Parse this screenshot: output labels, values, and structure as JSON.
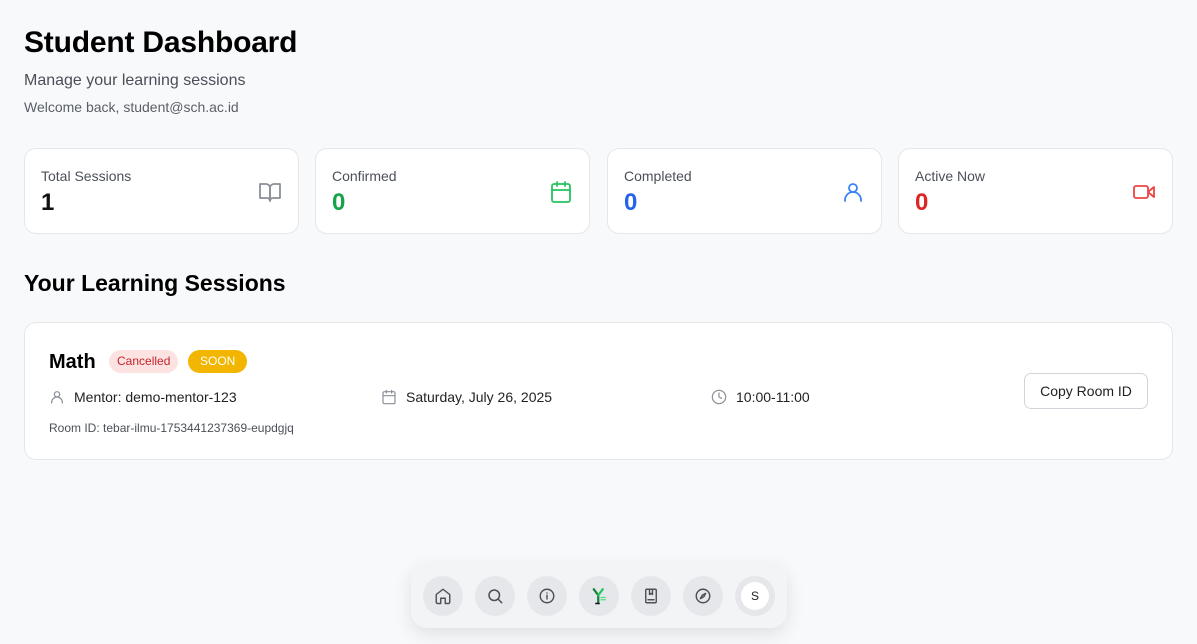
{
  "header": {
    "title": "Student Dashboard",
    "subtitle": "Manage your learning sessions",
    "welcome": "Welcome back, student@sch.ac.id"
  },
  "stats": [
    {
      "label": "Total Sessions",
      "value": "1",
      "icon": "book-open-icon",
      "color": "#111111"
    },
    {
      "label": "Confirmed",
      "value": "0",
      "icon": "calendar-icon",
      "color": "#16a34a"
    },
    {
      "label": "Completed",
      "value": "0",
      "icon": "user-icon",
      "color": "#2563eb"
    },
    {
      "label": "Active Now",
      "value": "0",
      "icon": "video-icon",
      "color": "#dc2626"
    }
  ],
  "sessions_section": {
    "title": "Your Learning Sessions",
    "items": [
      {
        "subject": "Math",
        "status_badge": "Cancelled",
        "time_badge": "SOON",
        "mentor": "Mentor: demo-mentor-123",
        "date": "Saturday, July 26, 2025",
        "time": "10:00-11:00",
        "room_id": "Room ID: tebar-ilmu-1753441237369-eupdgjq",
        "copy_label": "Copy Room ID"
      }
    ]
  },
  "dock": {
    "items": [
      "home-icon",
      "search-icon",
      "info-icon",
      "sprout-logo-icon",
      "bookmark-book-icon",
      "compass-icon"
    ],
    "avatar_initial": "S"
  }
}
